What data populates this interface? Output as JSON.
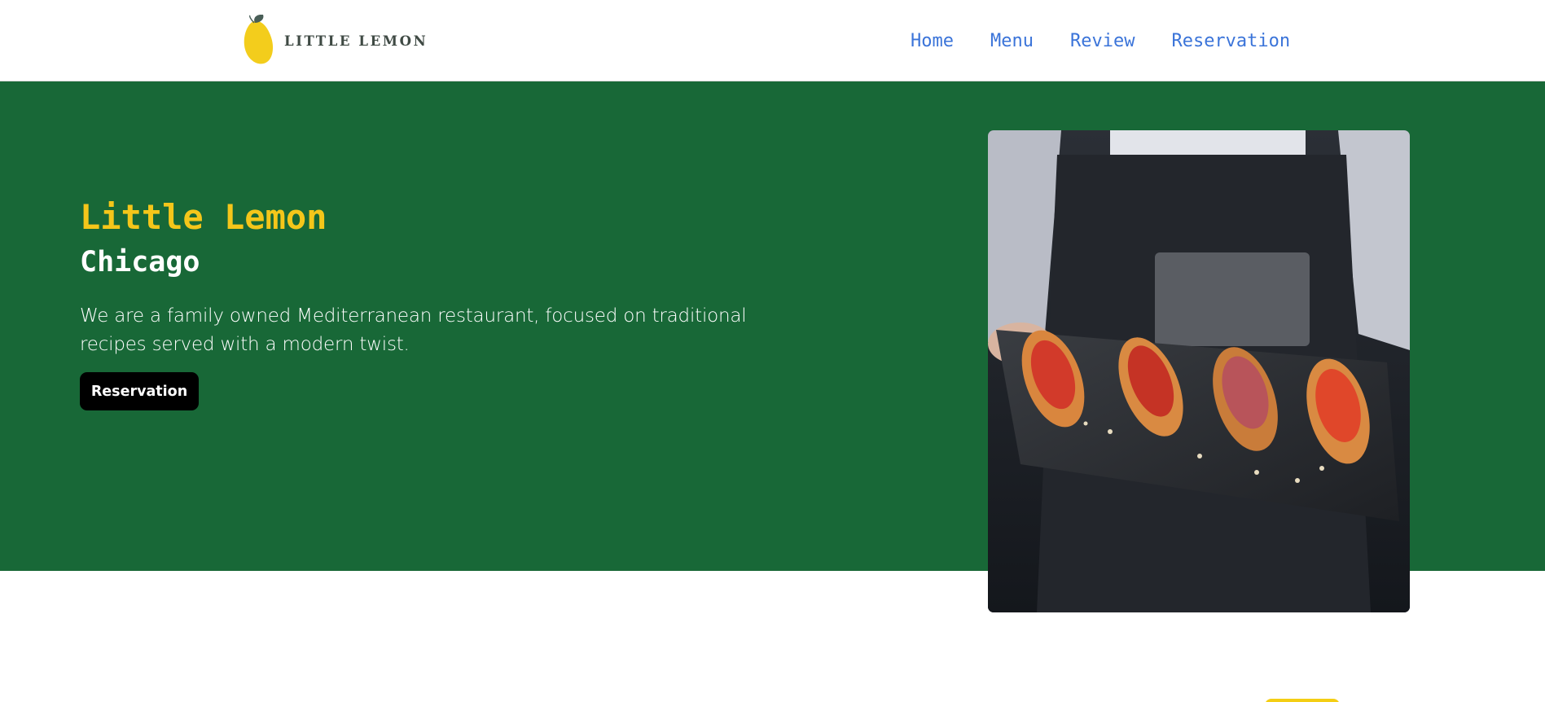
{
  "brand": {
    "logo_text": "LITTLE LEMON"
  },
  "nav": {
    "items": [
      {
        "label": "Home"
      },
      {
        "label": "Menu"
      },
      {
        "label": "Review"
      },
      {
        "label": "Reservation"
      }
    ]
  },
  "hero": {
    "title": "Little Lemon",
    "subtitle": "Chicago",
    "description": "We are a family owned Mediterranean restaurant, focused on traditional recipes served with a modern twist.",
    "cta_label": "Reservation"
  },
  "colors": {
    "hero_background": "#186837",
    "title_yellow": "#f4c61a",
    "nav_link": "#3b74d9",
    "button_black": "#000000"
  },
  "icons": {
    "logo": "lemon-logo-icon"
  }
}
